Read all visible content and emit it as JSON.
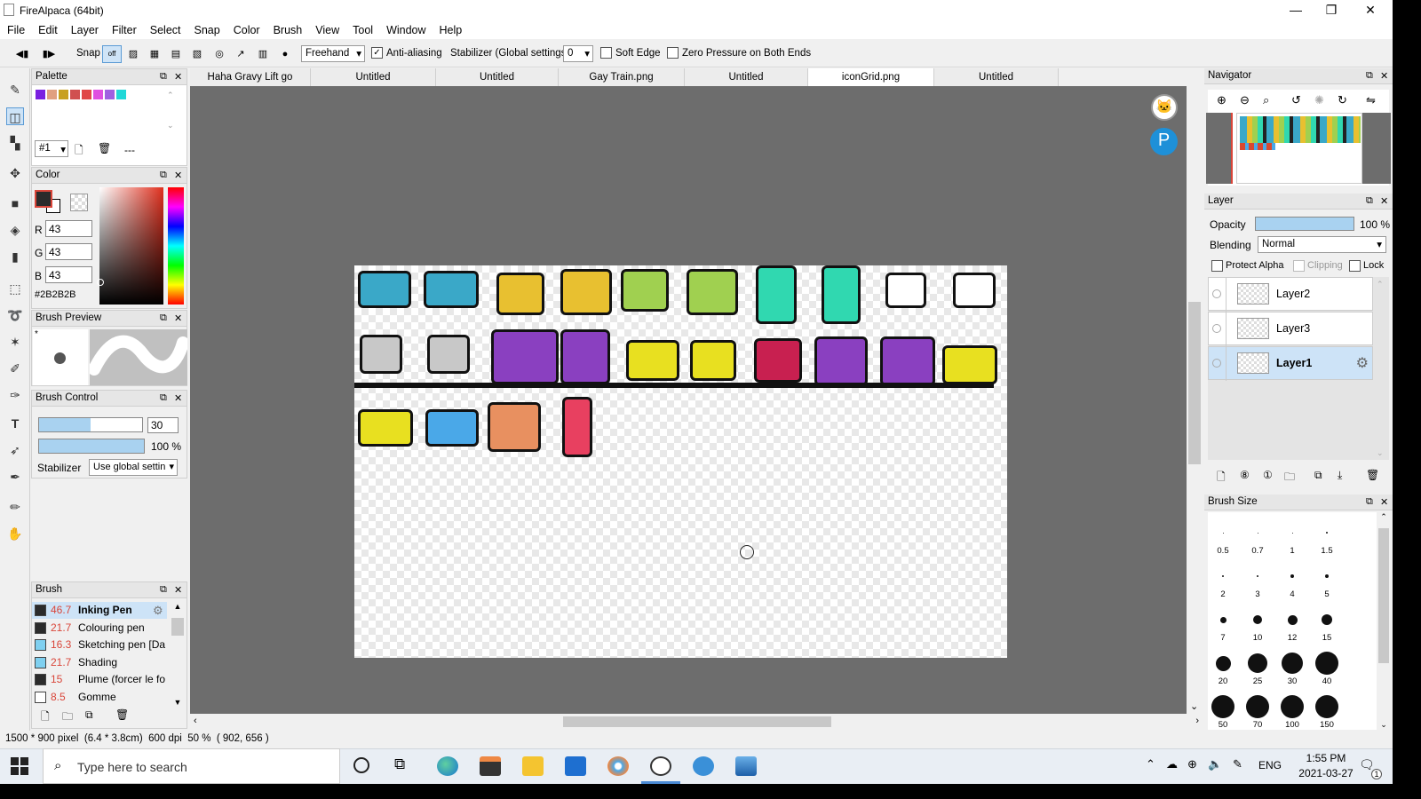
{
  "window": {
    "title": "FireAlpaca (64bit)",
    "minimize": "—",
    "maximize": "❐",
    "close": "✕"
  },
  "menu": [
    "File",
    "Edit",
    "Layer",
    "Filter",
    "Select",
    "Snap",
    "Color",
    "Brush",
    "View",
    "Tool",
    "Window",
    "Help"
  ],
  "toolbar": {
    "snap_label": "Snap",
    "snap_off": "off",
    "brush_mode": "Freehand",
    "antialias_label": "Anti-aliasing",
    "antialias_checked": true,
    "stabilizer_label": "Stabilizer (Global settings)",
    "stabilizer_value": "0",
    "soft_edge_label": "Soft Edge",
    "zero_pressure_label": "Zero Pressure on Both Ends"
  },
  "tabs": [
    "Haha Gravy Lift go yeet.mdp",
    "Untitled",
    "Untitled",
    "Gay Train.png",
    "Untitled",
    "iconGrid.png",
    "Untitled"
  ],
  "active_tab": 5,
  "palette": {
    "title": "Palette",
    "swatches": [
      "#7a1fe0",
      "#e0a080",
      "#c8a020",
      "#d05050",
      "#e04848",
      "#e050e0",
      "#a060e0",
      "#20d8d8"
    ],
    "index": "#1",
    "dash": "---"
  },
  "color": {
    "title": "Color",
    "r_label": "R",
    "g_label": "G",
    "b_label": "B",
    "r": "43",
    "g": "43",
    "b": "43",
    "hex": "#2B2B2B"
  },
  "brush_preview": {
    "title": "Brush Preview",
    "star": "*"
  },
  "brush_control": {
    "title": "Brush Control",
    "size": "30",
    "size_fill": 0.5,
    "opacity": "100 %",
    "stabilizer_label": "Stabilizer",
    "stabilizer_value": "Use global settin"
  },
  "brush_list": {
    "title": "Brush",
    "items": [
      {
        "size": "46.7",
        "name": "Inking Pen",
        "color": "#2b2b2b",
        "bold": true
      },
      {
        "size": "21.7",
        "name": "Colouring pen",
        "color": "#2b2b2b"
      },
      {
        "size": "16.3",
        "name": "Sketching pen [Da",
        "color": "#7fd0f0"
      },
      {
        "size": "21.7",
        "name": "Shading",
        "color": "#7fd0f0"
      },
      {
        "size": "15",
        "name": "Plume (forcer le fo",
        "color": "#2b2b2b"
      },
      {
        "size": "8.5",
        "name": "Gomme",
        "color": "#ffffff"
      }
    ]
  },
  "navigator": {
    "title": "Navigator"
  },
  "layer": {
    "title": "Layer",
    "opacity_label": "Opacity",
    "opacity": "100 %",
    "opacity_fill": 1.0,
    "blending_label": "Blending",
    "blending": "Normal",
    "protect_alpha": "Protect Alpha",
    "clipping": "Clipping",
    "lock": "Lock",
    "layers": [
      "Layer2",
      "Layer3",
      "Layer1"
    ],
    "active": "Layer1"
  },
  "brush_size": {
    "title": "Brush Size",
    "sizes": [
      "0.5",
      "0.7",
      "1",
      "1.5",
      "2",
      "3",
      "4",
      "5",
      "7",
      "10",
      "12",
      "15",
      "20",
      "25",
      "30",
      "40",
      "50",
      "70",
      "100",
      "150"
    ]
  },
  "status": {
    "dims": "1500 * 900 pixel",
    "cm": "(6.4 * 3.8cm)",
    "dpi": "600 dpi",
    "zoom": "50 %",
    "coords": "( 902, 656 )"
  },
  "taskbar": {
    "search_placeholder": "Type here to search",
    "time": "1:55 PM",
    "date": "2021-03-27",
    "lang": "ENG",
    "notif": "1"
  }
}
